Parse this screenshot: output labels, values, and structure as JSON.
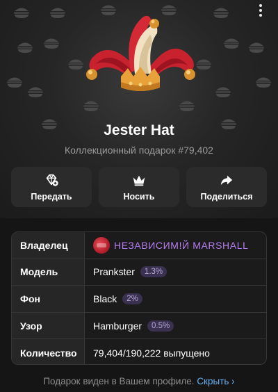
{
  "gift": {
    "title": "Jester Hat",
    "subtitle": "Коллекционный подарок #79,402"
  },
  "menu": {
    "icon": "more-vertical-icon"
  },
  "actions": [
    {
      "label": "Передать",
      "icon": "gift-transfer-icon"
    },
    {
      "label": "Носить",
      "icon": "crown-icon"
    },
    {
      "label": "Поделиться",
      "icon": "share-arrow-icon"
    }
  ],
  "info": {
    "owner": {
      "key": "Владелец",
      "name": "НЕЗАВИСИМ!Й MARSHALL"
    },
    "model": {
      "key": "Модель",
      "value": "Prankster",
      "rarity": "1.3%"
    },
    "backdrop": {
      "key": "Фон",
      "value": "Black",
      "rarity": "2%"
    },
    "pattern": {
      "key": "Узор",
      "value": "Hamburger",
      "rarity": "0.5%"
    },
    "quantity": {
      "key": "Количество",
      "value": "79,404/190,222 выпущено"
    }
  },
  "footer": {
    "text": "Подарок виден в Вашем профиле.",
    "link": "Скрыть ›"
  },
  "colors": {
    "accent_link": "#6ab2f2",
    "owner_name": "#b77df0",
    "badge_bg": "#3a3050"
  }
}
